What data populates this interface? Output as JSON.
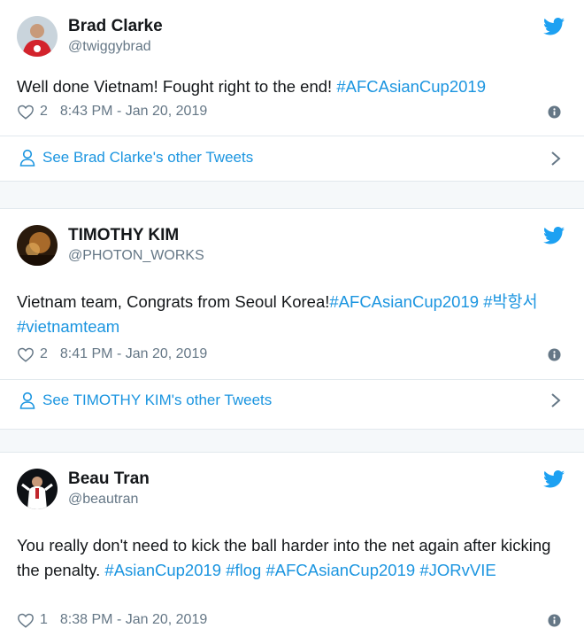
{
  "tweets": [
    {
      "name": "Brad Clarke",
      "handle": "@twiggybrad",
      "text_parts": [
        "Well done Vietnam! Fought right to the end! ",
        "#AFCAsianCup2019"
      ],
      "likes": "2",
      "time": "8:43 PM - Jan 20, 2019",
      "see_more": "See Brad Clarke's other Tweets"
    },
    {
      "name": "TIMOTHY KIM",
      "handle": "@PHOTON_WORKS",
      "text_parts": [
        "Vietnam team, Congrats from Seoul Korea!",
        "#AFCAsianCup2019",
        " ",
        "#박항서",
        " ",
        "#vietnamteam"
      ],
      "likes": "2",
      "time": "8:41 PM - Jan 20, 2019",
      "see_more": "See TIMOTHY KIM's other Tweets"
    },
    {
      "name": "Beau Tran",
      "handle": "@beautran",
      "text_parts": [
        "You really don't need to kick the ball harder into the net again after kicking the penalty. ",
        "#AsianCup2019",
        " ",
        "#flog",
        " ",
        "#AFCAsianCup2019",
        " ",
        "#JORvVIE"
      ],
      "likes": "1",
      "time": "8:38 PM - Jan 20, 2019"
    }
  ],
  "colors": {
    "link": "#1b95e0",
    "muted": "#657786",
    "text": "#14171a",
    "twitter_blue": "#1da1f2"
  },
  "icons": [
    "twitter-bird-icon",
    "heart-icon",
    "info-icon",
    "person-icon",
    "chevron-right-icon"
  ]
}
